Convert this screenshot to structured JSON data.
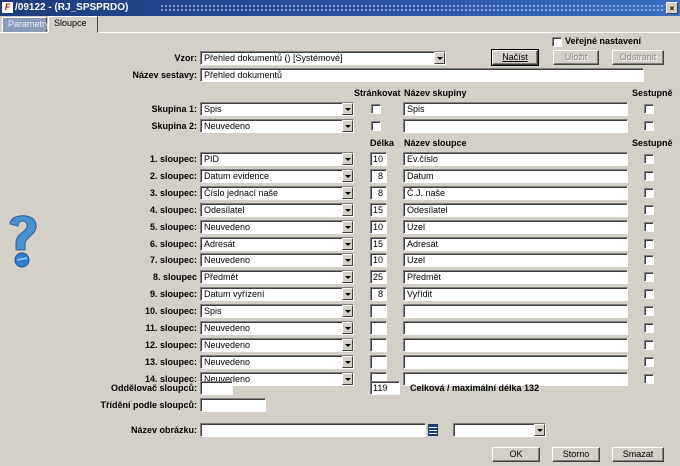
{
  "window": {
    "title": "/09122 - (RJ_SPSPRDO)",
    "close_glyph": "×"
  },
  "tabs": [
    {
      "label": "Parametry"
    },
    {
      "label": "Sloupce"
    }
  ],
  "vzor": {
    "label": "Vzor:",
    "value": "Přehled dokumentů   ()   [Systémové]"
  },
  "verejne": {
    "label": "Veřejné nastavení"
  },
  "buttons": {
    "nacist": "Načíst",
    "ulozit": "Uložit",
    "odstranit": "Odstranit",
    "ok": "OK",
    "storno": "Storno",
    "smazat": "Smazat"
  },
  "nazev_sestavy": {
    "label": "Název sestavy:",
    "value": "Přehled dokumentů"
  },
  "group_headers": {
    "strankovat": "Stránkovat",
    "nazev_skupiny": "Název skupiny",
    "sestupne": "Sestupně"
  },
  "groups": [
    {
      "label": "Skupina 1:",
      "value": "Spis",
      "name": "Spis"
    },
    {
      "label": "Skupina 2:",
      "value": "Neuvedeno",
      "name": ""
    }
  ],
  "column_headers": {
    "delka": "Délka",
    "nazev_sloupce": "Název sloupce",
    "sestupne": "Sestupně"
  },
  "columns": [
    {
      "label": "1. sloupec:",
      "value": "PID",
      "length": "10",
      "name": "Ev.číslo"
    },
    {
      "label": "2. sloupec:",
      "value": "Datum evidence",
      "length": "8",
      "name": "Datum"
    },
    {
      "label": "3. sloupec:",
      "value": "Číslo jednací naše",
      "length": "8",
      "name": "Č.J. naše"
    },
    {
      "label": "4. sloupec:",
      "value": "Odesílatel",
      "length": "15",
      "name": "Odesílatel"
    },
    {
      "label": "5. sloupec:",
      "value": "Neuvedeno",
      "length": "10",
      "name": "Uzel"
    },
    {
      "label": "6. sloupec:",
      "value": "Adresát",
      "length": "15",
      "name": "Adresát"
    },
    {
      "label": "7. sloupec:",
      "value": "Neuvedeno",
      "length": "10",
      "name": "Uzel"
    },
    {
      "label": "8. sloupec",
      "value": "Předmět",
      "length": "25",
      "name": "Předmět"
    },
    {
      "label": "9. sloupec:",
      "value": "Datum vyřízení",
      "length": "8",
      "name": "Vyřídit"
    },
    {
      "label": "10. sloupec:",
      "value": "Spis",
      "length": "",
      "name": ""
    },
    {
      "label": "11. sloupec:",
      "value": "Neuvedeno",
      "length": "",
      "name": ""
    },
    {
      "label": "12. sloupec:",
      "value": "Neuvedeno",
      "length": "",
      "name": ""
    },
    {
      "label": "13. sloupec:",
      "value": "Neuvedeno",
      "length": "",
      "name": ""
    },
    {
      "label": "14. sloupec:",
      "value": "Neuvedeno",
      "length": "",
      "name": ""
    }
  ],
  "oddelovac": {
    "label": "Oddělovač sloupců:",
    "value": ""
  },
  "total": {
    "value": "119",
    "label": "Celková / maximální délka 132"
  },
  "trideni": {
    "label": "Třídění podle sloupců:",
    "value": ""
  },
  "nazev_obrazku": {
    "label": "Název obrázku:",
    "value": "",
    "select_value": ""
  },
  "icons": {
    "help": "question-help-icon",
    "list": "list-picker-icon"
  },
  "colors": {
    "titlebar": "#1c3c7c",
    "background": "#d4d0c8"
  }
}
